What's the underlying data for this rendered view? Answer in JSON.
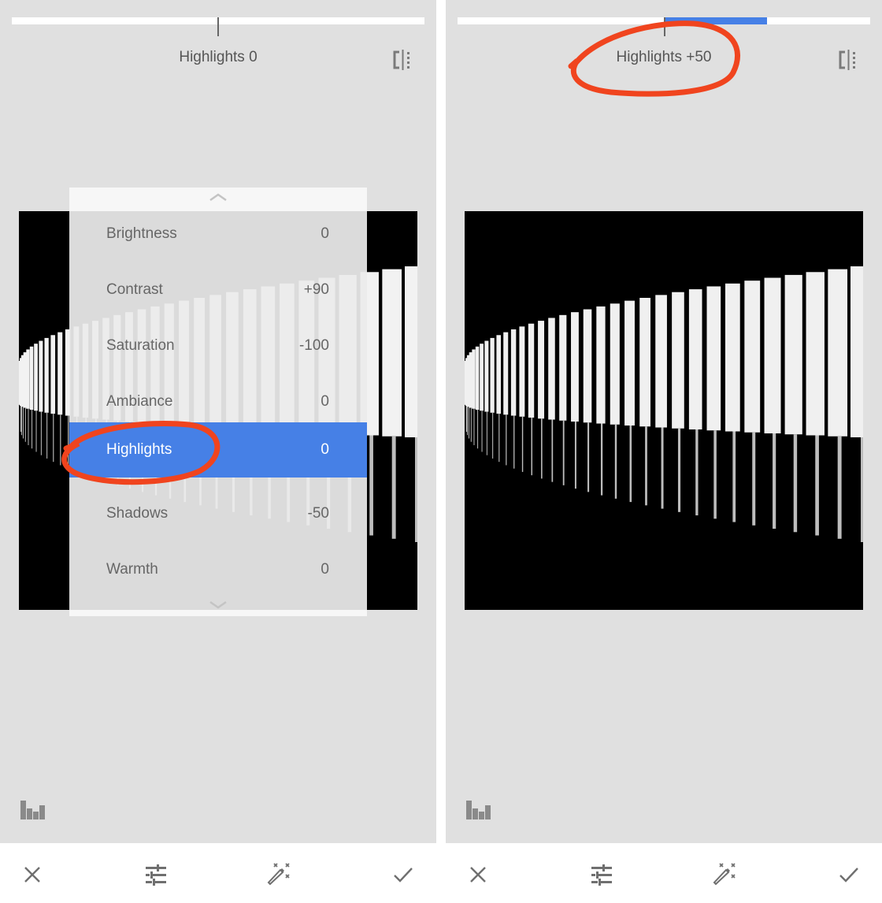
{
  "colors": {
    "accent": "#4680e6",
    "annotation": "#f0441e",
    "background": "#e0e0e0",
    "text": "#555555",
    "icon": "#6f6f6f"
  },
  "left_panel": {
    "adjustment_label": "Highlights 0",
    "slider_value": 0,
    "slider_range": [
      -100,
      100
    ],
    "menu": {
      "items": [
        {
          "label": "Brightness",
          "value": "0"
        },
        {
          "label": "Contrast",
          "value": "+90"
        },
        {
          "label": "Saturation",
          "value": "-100"
        },
        {
          "label": "Ambiance",
          "value": "0"
        },
        {
          "label": "Highlights",
          "value": "0",
          "selected": true
        },
        {
          "label": "Shadows",
          "value": "-50"
        },
        {
          "label": "Warmth",
          "value": "0"
        }
      ]
    }
  },
  "right_panel": {
    "adjustment_label": "Highlights +50",
    "slider_value": 50,
    "slider_range": [
      -100,
      100
    ]
  },
  "icons": {
    "compare": "compare-split-icon",
    "histogram": "histogram-icon",
    "cancel": "close-icon",
    "tune": "sliders-icon",
    "auto": "magic-wand-icon",
    "apply": "checkmark-icon"
  }
}
